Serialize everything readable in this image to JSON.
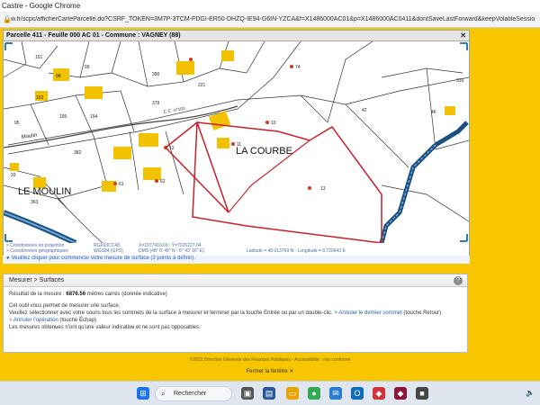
{
  "browser": {
    "window_title": "Castre - Google Chrome",
    "url": "w.fr/scpc/afficherCarteParcelle.do?CSRF_TOKEN=3M7P-3TCM-FDGI-ER50-DHZQ-IE94-G6IN-YZCA&f=X1486000AC01&p=X1486000AC0411&dontSaveLastForward&keepVolatileSessio"
  },
  "map": {
    "header_title": "Parcelle 411 - Feuille 000 AC 01 - Commune : VAGNEY (88)",
    "close_symbol": "✕",
    "place_labels": [
      "LA COURBE",
      "LE MOULIN"
    ],
    "road_label": "Moulin",
    "road_label2": "C.C. n°101",
    "parcel_numbers": [
      "151",
      "98",
      "99",
      "390",
      "379",
      "221",
      "152",
      "95",
      "195",
      "194",
      "93",
      "382",
      "363",
      "61",
      "62",
      "12",
      "11",
      "10",
      "74",
      "42",
      "46",
      "13",
      "316"
    ],
    "footer": {
      "c1a": "> Coordonnées en projection",
      "c1b": "> Coordonnées géographiques",
      "c2a": "RGF93CC48",
      "c2b": "WGS84 (GPS)",
      "c3a": "X=1977410.69 ; Y=7226227.04",
      "c3b": "DMS (48° 0' 49\" N - 6° 43' 16\" E)",
      "c4": "Latitude = 48.013769 N - Longitude = 6.720643 E"
    },
    "hint": "Veuillez cliquer pour commencer votre mesure de surface (3 points à définir)."
  },
  "measure": {
    "title": "Mesurer > Surfaces",
    "result_label": "Résultat de la mesure :",
    "result_value": "6876.56",
    "result_unit": "mètres carrés",
    "result_note": "(donnée indicative)",
    "line1": "Cet outil vous permet de mesurer une surface.",
    "line2": "Veuillez sélectionner avec votre souris tous les sommets de la surface à mesurer et terminer par la touche Entrée ou par un double-clic.",
    "link_undo": "> Annuler le dernier sommet",
    "undo_key": "(touche Retour)",
    "link_cancel": "> Annuler l'opération",
    "cancel_key": "(touche Échap)",
    "line3": "Les mesures obtenues n'ont qu'une valeur indicative et ne sont pas opposables.",
    "help": "?"
  },
  "footer": {
    "copyright": "©2022 Direction Générale des Finances Publiques",
    "sep": "-",
    "accessibility": "Accessibilité : non conforme",
    "close_window": "Fermer la fenêtre",
    "close_x": "✕"
  },
  "taskbar": {
    "search_placeholder": "Rechercher",
    "time": "🔈"
  }
}
